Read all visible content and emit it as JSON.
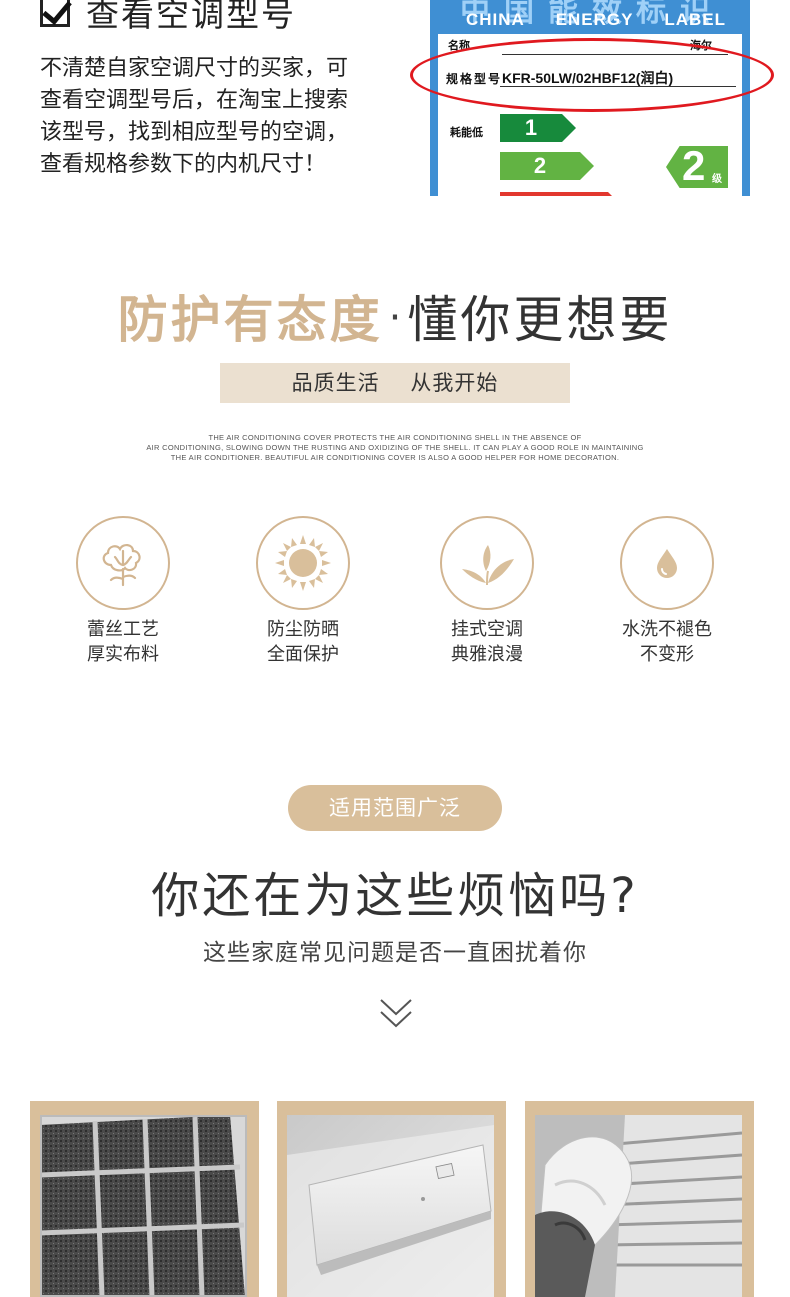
{
  "model_section": {
    "title": "查看空调型号",
    "description_lines": [
      "不清楚自家空调尺寸的买家，可",
      "查看空调型号后，在淘宝上搜索",
      "该型号，找到相应型号的空调，",
      "查看规格参数下的内机尺寸！"
    ],
    "label": {
      "cn_title": "中国能效标识",
      "en_words": [
        "CHINA",
        "ENERGY",
        "LABEL"
      ],
      "row1_label": "名称",
      "row1_value": "海尔",
      "model_label": "规格型号",
      "model_value": "KFR-50LW/02HBF12(润白)",
      "low_consumption_label": "耗能低",
      "grade_bars": [
        "1",
        "2"
      ],
      "grade_value": "2",
      "grade_unit": "级",
      "highlight_color": "#e0191f"
    }
  },
  "protection_section": {
    "title_gold": "防护有态度",
    "title_dot": "·",
    "title_dark": "懂你更想要",
    "subtitle": "品质生活    从我开始",
    "english_lines": [
      "THE AIR CONDITIONING COVER PROTECTS THE AIR CONDITIONING SHELL IN THE ABSENCE OF",
      "AIR CONDITIONING, SLOWING DOWN THE RUSTING AND OXIDIZING OF THE SHELL. IT CAN PLAY A GOOD ROLE IN MAINTAINING",
      "THE AIR CONDITIONER. BEAUTIFUL AIR CONDITIONING COVER IS ALSO A GOOD HELPER FOR HOME DECORATION."
    ],
    "features": [
      {
        "icon": "cotton-icon",
        "line1": "蕾丝工艺",
        "line2": "厚实布料"
      },
      {
        "icon": "sun-icon",
        "line1": "防尘防晒",
        "line2": "全面保护"
      },
      {
        "icon": "leaf-icon",
        "line1": "挂式空调",
        "line2": "典雅浪漫"
      },
      {
        "icon": "water-drop-icon",
        "line1": "水洗不褪色",
        "line2": "不变形"
      }
    ],
    "accent_color": "#d2b591"
  },
  "problems_section": {
    "pill_label": "适用范围广泛",
    "title": "你还在为这些烦恼吗?",
    "subtitle": "这些家庭常见问题是否一直困扰着你",
    "chevron_icon": "chevron-down-icon",
    "photos": [
      "dusty-filter-photo",
      "wall-ac-unit-photo",
      "cleaning-vents-photo"
    ]
  }
}
